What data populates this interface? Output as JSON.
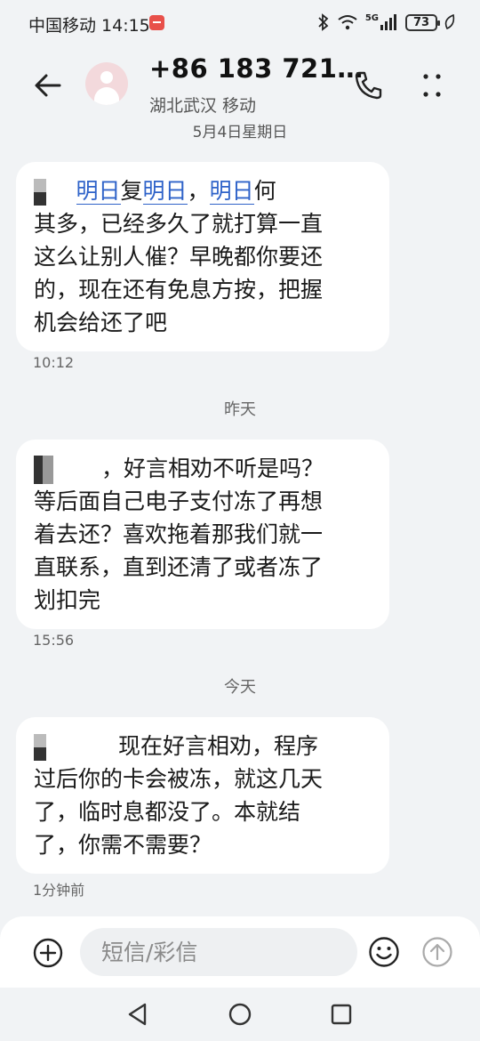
{
  "status_bar": {
    "carrier": "中国移动",
    "time": "14:15",
    "network": "5G",
    "battery": "73"
  },
  "header": {
    "contact_name": "+86 183 721…",
    "location": "湖北武汉 移动",
    "date": "5月4日星期日"
  },
  "messages": [
    {
      "segments": [
        "明日",
        "复",
        "明日",
        "，",
        "明日",
        "何\n其多，已经多久了就打算一直\n这么让别人催？早晚都你要还\n的，现在还有免息方按，把握\n机会给还了吧"
      ],
      "time": "10:12"
    },
    {
      "day_separator": "昨天",
      "prefix": "，",
      "text": "好言相劝不听是吗？\n等后面自己电子支付冻了再想\n着去还？喜欢拖着那我们就一\n直联系，直到还清了或者冻了\n划扣完",
      "time": "15:56"
    },
    {
      "day_separator": "今天",
      "text": "现在好言相劝，程序\n过后你的卡会被冻，就这几天\n了，临时息都没了。本就结\n了，你需不需要？",
      "time": "1分钟前"
    }
  ],
  "composer": {
    "placeholder": "短信/彩信"
  },
  "colors": {
    "link": "#2f63c9",
    "background": "#f1f3f5",
    "bubble": "#ffffff",
    "notification": "#e8504a"
  },
  "icons": [
    "back-arrow-icon",
    "avatar-icon",
    "phone-icon",
    "more-vertical-icon",
    "add-icon",
    "emoji-icon",
    "send-icon",
    "nav-back-icon",
    "nav-home-icon",
    "nav-recent-icon"
  ]
}
